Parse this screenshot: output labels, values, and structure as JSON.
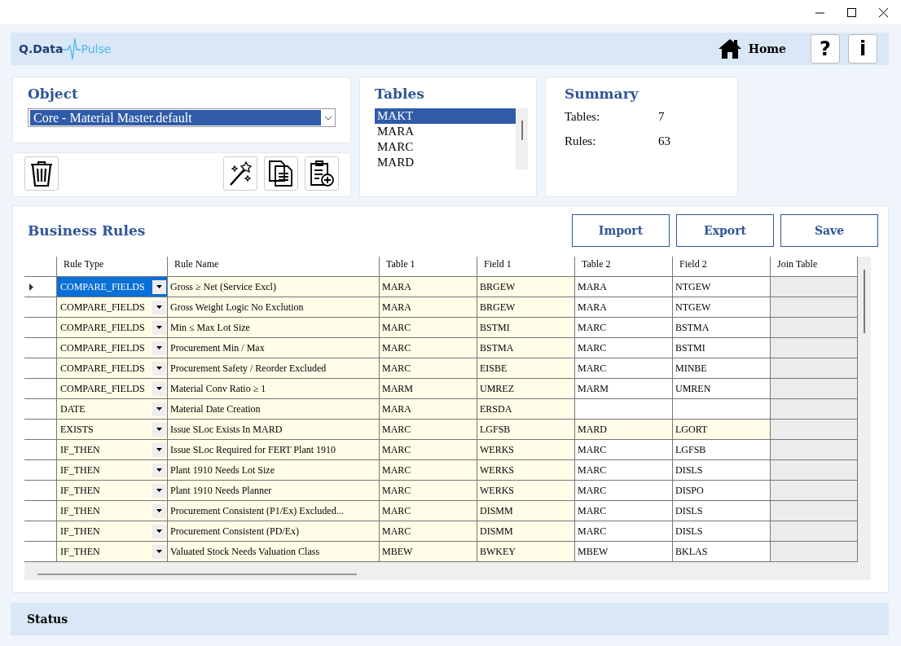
{
  "header": {
    "logo_left": "Q.Data",
    "logo_right": "Pulse",
    "home": "Home",
    "help": "?",
    "info": "i"
  },
  "object": {
    "title": "Object",
    "value": "Core - Material Master.default"
  },
  "tables": {
    "title": "Tables",
    "items": [
      {
        "label": "MAKT",
        "selected": true
      },
      {
        "label": "MARA",
        "selected": false
      },
      {
        "label": "MARC",
        "selected": false
      },
      {
        "label": "MARD",
        "selected": false
      }
    ]
  },
  "summary": {
    "title": "Summary",
    "rows": [
      {
        "label": "Tables:",
        "value": "7"
      },
      {
        "label": "Rules:",
        "value": "63"
      }
    ]
  },
  "business_rules": {
    "title": "Business Rules",
    "buttons": [
      "Import",
      "Export",
      "Save"
    ],
    "columns": [
      "Rule Type",
      "Rule Name",
      "Table 1",
      "Field 1",
      "Table 2",
      "Field 2",
      "Join Table"
    ],
    "rows": [
      {
        "selected": true,
        "table2_highlighted": false,
        "cells": [
          "COMPARE_FIELDS",
          "Gross ≥ Net (Service Excl)",
          "MARA",
          "BRGEW",
          "MARA",
          "NTGEW"
        ]
      },
      {
        "selected": false,
        "table2_highlighted": false,
        "cells": [
          "COMPARE_FIELDS",
          "Gross Weight Logic No Exclution",
          "MARA",
          "BRGEW",
          "MARA",
          "NTGEW"
        ]
      },
      {
        "selected": false,
        "table2_highlighted": false,
        "cells": [
          "COMPARE_FIELDS",
          "Min ≤ Max Lot Size",
          "MARC",
          "BSTMI",
          "MARC",
          "BSTMA"
        ]
      },
      {
        "selected": false,
        "table2_highlighted": false,
        "cells": [
          "COMPARE_FIELDS",
          "Procurement Min / Max",
          "MARC",
          "BSTMA",
          "MARC",
          "BSTMI"
        ]
      },
      {
        "selected": false,
        "table2_highlighted": false,
        "cells": [
          "COMPARE_FIELDS",
          "Procurement Safety / Reorder Excluded",
          "MARC",
          "EISBE",
          "MARC",
          "MINBE"
        ]
      },
      {
        "selected": false,
        "table2_highlighted": false,
        "cells": [
          "COMPARE_FIELDS",
          "Material Conv Ratio ≥ 1",
          "MARM",
          "UMREZ",
          "MARM",
          "UMREN"
        ]
      },
      {
        "selected": false,
        "table2_highlighted": false,
        "cells": [
          "DATE",
          "Material Date Creation",
          "MARA",
          "ERSDA",
          "",
          ""
        ]
      },
      {
        "selected": false,
        "table2_highlighted": true,
        "cells": [
          "EXISTS",
          "Issue SLoc Exists In MARD",
          "MARC",
          "LGFSB",
          "MARD",
          "LGORT"
        ]
      },
      {
        "selected": false,
        "table2_highlighted": false,
        "cells": [
          "IF_THEN",
          "Issue SLoc Required for FERT Plant 1910",
          "MARC",
          "WERKS",
          "MARC",
          "LGFSB"
        ]
      },
      {
        "selected": false,
        "table2_highlighted": false,
        "cells": [
          "IF_THEN",
          "Plant 1910 Needs Lot Size",
          "MARC",
          "WERKS",
          "MARC",
          "DISLS"
        ]
      },
      {
        "selected": false,
        "table2_highlighted": false,
        "cells": [
          "IF_THEN",
          "Plant 1910 Needs Planner",
          "MARC",
          "WERKS",
          "MARC",
          "DISPO"
        ]
      },
      {
        "selected": false,
        "table2_highlighted": false,
        "cells": [
          "IF_THEN",
          "Procurement Consistent (P1/Ex) Excluded...",
          "MARC",
          "DISMM",
          "MARC",
          "DISLS"
        ]
      },
      {
        "selected": false,
        "table2_highlighted": false,
        "cells": [
          "IF_THEN",
          "Procurement Consistent (PD/Ex)",
          "MARC",
          "DISMM",
          "MARC",
          "DISLS"
        ]
      },
      {
        "selected": false,
        "table2_highlighted": false,
        "cells": [
          "IF_THEN",
          "Valuated Stock Needs Valuation Class",
          "MBEW",
          "BWKEY",
          "MBEW",
          "BKLAS"
        ]
      }
    ]
  },
  "status_bar": {
    "label": "Status"
  }
}
